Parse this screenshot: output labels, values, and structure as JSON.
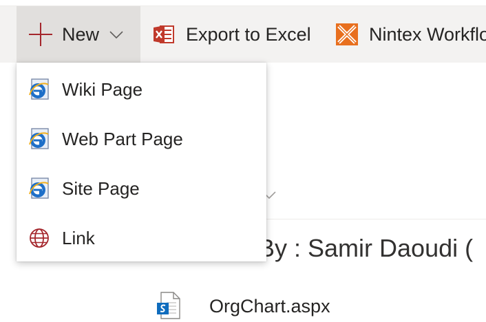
{
  "commandbar": {
    "new_label": "New",
    "export_label": "Export to Excel",
    "nintex_label": "Nintex Workflo"
  },
  "new_menu": {
    "items": [
      {
        "label": "Wiki Page",
        "icon": "ie-page-icon"
      },
      {
        "label": "Web Part Page",
        "icon": "ie-page-icon"
      },
      {
        "label": "Site Page",
        "icon": "ie-page-icon"
      },
      {
        "label": "Link",
        "icon": "globe-icon"
      }
    ]
  },
  "background": {
    "author_text": "By : Samir Daoudi (",
    "file_name": "OrgChart.aspx"
  },
  "colors": {
    "accent_red": "#a4262c",
    "excel_red": "#c0392b",
    "nintex_orange": "#e86f1e",
    "ie_blue": "#1e6fc8"
  }
}
